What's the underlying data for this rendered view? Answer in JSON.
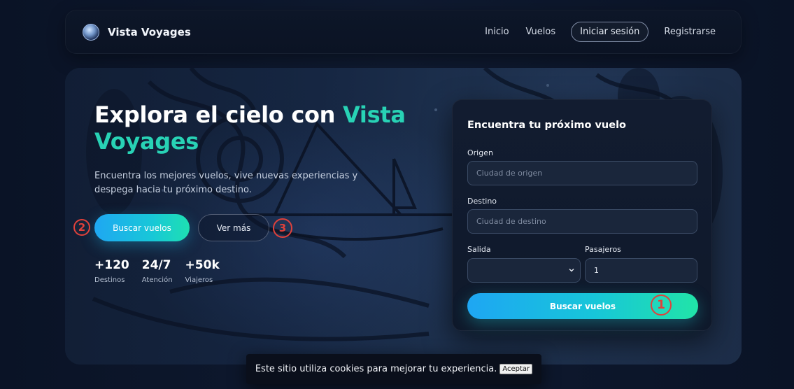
{
  "navbar": {
    "brand": "Vista Voyages",
    "links": [
      "Inicio",
      "Vuelos"
    ],
    "login": "Iniciar sesión",
    "register": "Registrarse"
  },
  "hero": {
    "title_part1": "Explora el cielo con ",
    "title_accent": "Vista Voyages",
    "subtitle": "Encuentra los mejores vuelos, vive nuevas experiencias y despega hacia tu próximo destino.",
    "primary_button": "Buscar vuelos",
    "secondary_button": "Ver más",
    "stats": [
      {
        "num": "+120",
        "label": "Destinos"
      },
      {
        "num": "24/7",
        "label": "Atención"
      },
      {
        "num": "+50k",
        "label": "Viajeros"
      }
    ]
  },
  "search_card": {
    "title": "Encuentra tu próximo vuelo",
    "origin_label": "Origen",
    "origin_placeholder": "Ciudad de origen",
    "destination_label": "Destino",
    "destination_placeholder": "Ciudad de destino",
    "departure_label": "Salida",
    "departure_value": "",
    "passengers_label": "Pasajeros",
    "passengers_value": "1",
    "search_button": "Buscar vuelos"
  },
  "markers": [
    "1",
    "2",
    "3"
  ],
  "cookie": {
    "text": "Este sitio utiliza cookies para mejorar tu experiencia.",
    "accept": "Aceptar"
  },
  "colors": {
    "accent_teal": "#28d2b5",
    "button_gradient_start": "#1fa7f2",
    "button_gradient_end": "#1ee0b2",
    "marker_red": "#e0413b"
  }
}
